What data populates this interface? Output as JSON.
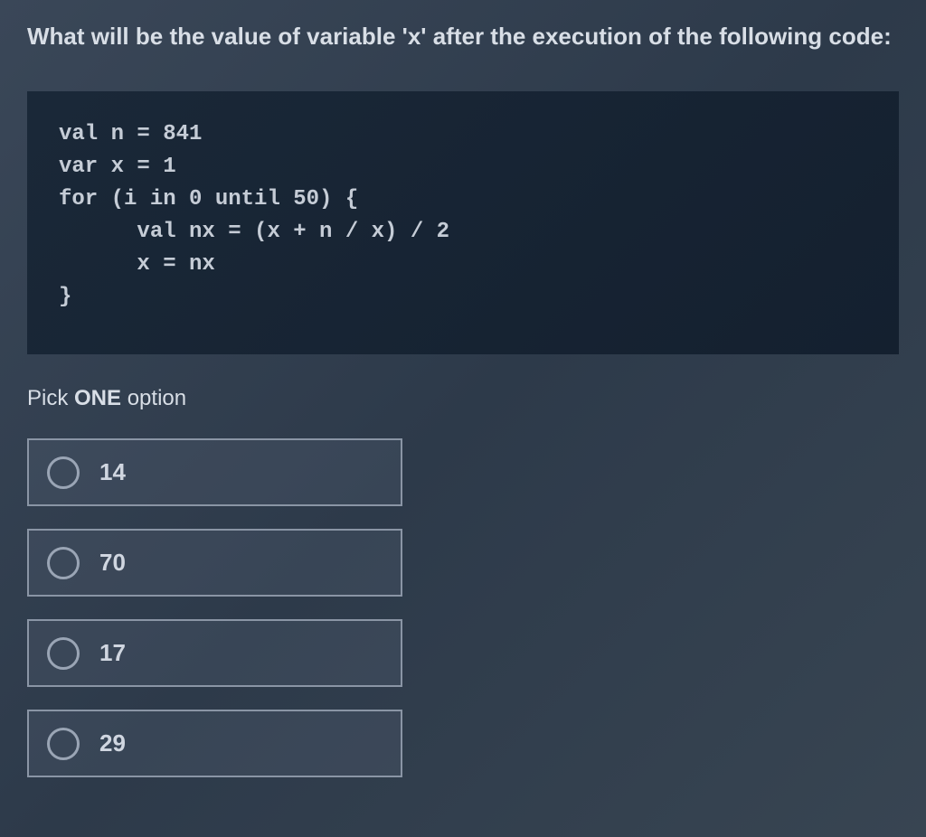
{
  "question": {
    "title": "What will be the value of variable 'x' after the execution of the following code:",
    "code": "val n = 841\nvar x = 1\nfor (i in 0 until 50) {\n      val nx = (x + n / x) / 2\n      x = nx\n}"
  },
  "prompt": {
    "prefix": "Pick ",
    "bold": "ONE",
    "suffix": " option"
  },
  "options": [
    {
      "label": "14"
    },
    {
      "label": "70"
    },
    {
      "label": "17"
    },
    {
      "label": "29"
    }
  ]
}
